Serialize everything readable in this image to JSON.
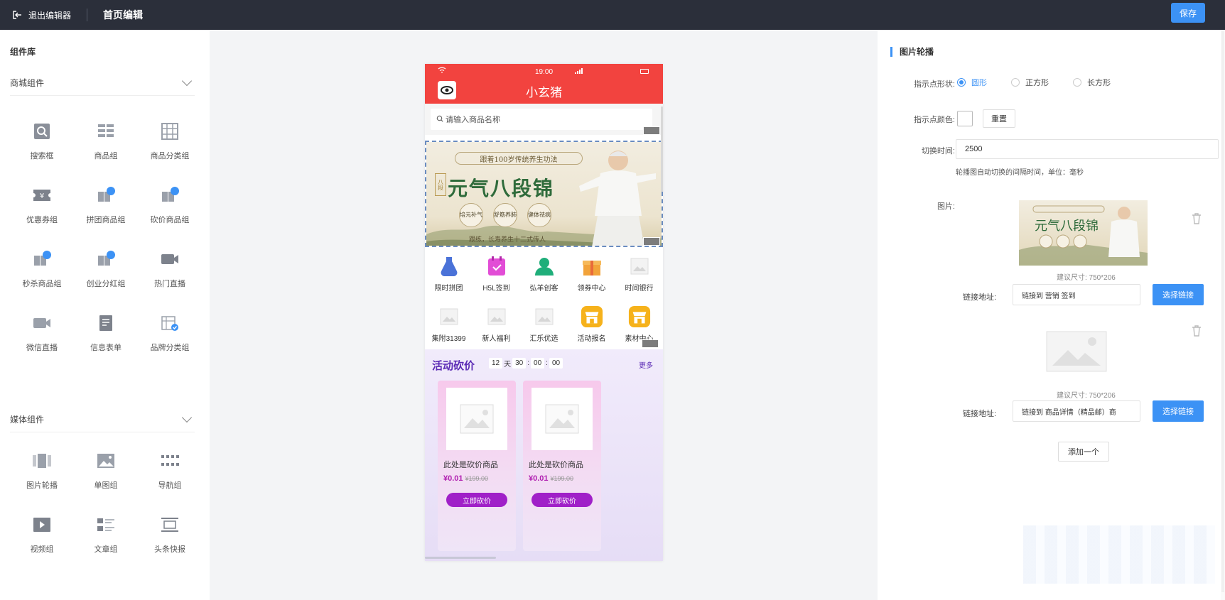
{
  "topbar": {
    "exit_label": "退出编辑器",
    "title": "首页编辑",
    "save_label": "保存"
  },
  "left": {
    "library_title": "组件库",
    "categories": [
      {
        "name": "商城组件",
        "items": [
          "搜索框",
          "商品组",
          "商品分类组",
          "优惠券组",
          "拼团商品组",
          "砍价商品组",
          "秒杀商品组",
          "创业分红组",
          "热门直播",
          "微信直播",
          "信息表单",
          "品牌分类组"
        ]
      },
      {
        "name": "媒体组件",
        "items": [
          "图片轮播",
          "单图组",
          "导航组",
          "视频组",
          "文章组",
          "头条快报"
        ]
      }
    ]
  },
  "phone": {
    "status_time": "19:00",
    "shop_name": "小玄猪",
    "search_placeholder": "请输入商品名称",
    "banner": {
      "ribbon": "跟着100岁传统养生功法",
      "headline": "元气八段锦",
      "seal": "八段",
      "circles": [
        "培元补气",
        "舒筋养肺",
        "健体祛病"
      ],
      "footer": "跟练，长寿养生十二式传人"
    },
    "nav_items": [
      "限时拼团",
      "H5L签到",
      "弘羊创客",
      "领券中心",
      "时间银行",
      "集附31399",
      "新人福利",
      "汇乐优选",
      "活动报名",
      "素材中心"
    ],
    "bargain": {
      "title": "活动砍价",
      "timer": [
        "12",
        "天",
        "30",
        ":",
        "00",
        ":",
        "00"
      ],
      "more": "更多",
      "goods": [
        {
          "name": "此处是砍价商品",
          "price": "¥0.01",
          "orig": "¥199.00",
          "btn": "立即砍价"
        },
        {
          "name": "此处是砍价商品",
          "price": "¥0.01",
          "orig": "¥199.00",
          "btn": "立即砍价"
        }
      ]
    }
  },
  "right": {
    "section_title": "图片轮播",
    "dot_shape_label": "指示点形状:",
    "dot_shapes": [
      "圆形",
      "正方形",
      "长方形"
    ],
    "dot_color_label": "指示点颜色:",
    "reset_label": "重置",
    "interval_label": "切换时间:",
    "interval_value": "2500",
    "interval_hint": "轮播图自动切换的间隔时间，单位：毫秒",
    "image_label": "图片:",
    "images": [
      {
        "size_tip": "建议尺寸: 750*206",
        "link_label": "链接地址:",
        "link_value": "链接到 营销 签到",
        "choose_label": "选择链接"
      },
      {
        "size_tip": "建议尺寸: 750*206",
        "link_label": "链接地址:",
        "link_value": "链接到 商品详情（精品邮）商",
        "choose_label": "选择链接"
      }
    ],
    "add_label": "添加一个"
  },
  "colors": {
    "topbar": "#2b2f3a",
    "primary": "#3c92f5",
    "phone_header": "#f2433f",
    "bargain_purple": "#a020c8"
  }
}
